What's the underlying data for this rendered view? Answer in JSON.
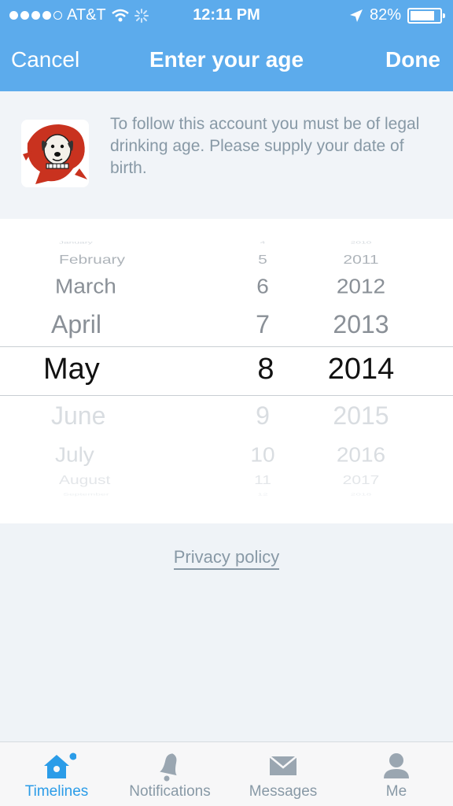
{
  "status_bar": {
    "carrier": "AT&T",
    "time": "12:11 PM",
    "battery": "82%",
    "battery_level": 0.82
  },
  "nav": {
    "cancel_label": "Cancel",
    "title": "Enter your age",
    "done_label": "Done"
  },
  "account": {
    "message": "To follow this account you must be of legal drinking age. Please supply your date of birth."
  },
  "picker": {
    "rows": [
      {
        "month": "January",
        "day": "4",
        "year": "2010"
      },
      {
        "month": "February",
        "day": "5",
        "year": "2011"
      },
      {
        "month": "March",
        "day": "6",
        "year": "2012"
      },
      {
        "month": "April",
        "day": "7",
        "year": "2013"
      },
      {
        "month": "May",
        "day": "8",
        "year": "2014"
      },
      {
        "month": "June",
        "day": "9",
        "year": "2015"
      },
      {
        "month": "July",
        "day": "10",
        "year": "2016"
      },
      {
        "month": "August",
        "day": "11",
        "year": "2017"
      },
      {
        "month": "September",
        "day": "12",
        "year": "2018"
      }
    ],
    "selected": {
      "month": "May",
      "day": "8",
      "year": "2014"
    }
  },
  "privacy_label": "Privacy policy",
  "tabs": [
    {
      "label": "Timelines",
      "icon": "home-icon",
      "active": true
    },
    {
      "label": "Notifications",
      "icon": "bell-icon",
      "active": false
    },
    {
      "label": "Messages",
      "icon": "envelope-icon",
      "active": false
    },
    {
      "label": "Me",
      "icon": "person-icon",
      "active": false
    }
  ],
  "colors": {
    "header": "#5cabec",
    "accent": "#2b9ce8",
    "muted_text": "#8899a6"
  }
}
